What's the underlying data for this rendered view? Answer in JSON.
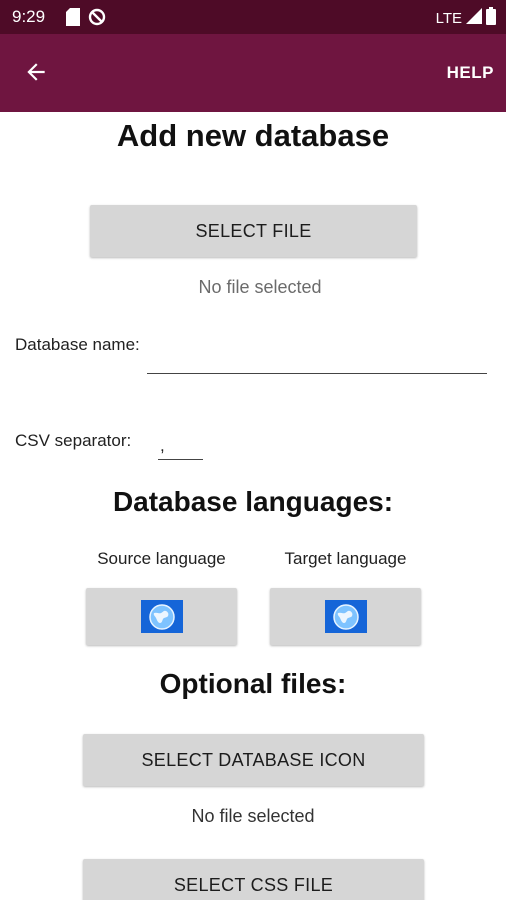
{
  "status_bar": {
    "time": "9:29",
    "network": "LTE"
  },
  "app_bar": {
    "back_icon": "arrow-left-icon",
    "help_label": "HELP",
    "background": "#6f1540"
  },
  "form": {
    "title": "Add new database",
    "select_file_label": "SELECT FILE",
    "no_file_text": "No file selected",
    "db_name_label": "Database name:",
    "db_name_value": "",
    "csv_separator_label": "CSV separator:",
    "csv_separator_value": ","
  },
  "languages": {
    "title": "Database languages:",
    "source_label": "Source language",
    "target_label": "Target language",
    "icon": "globe-icon"
  },
  "optional": {
    "title": "Optional files:",
    "select_icon_label": "SELECT DATABASE ICON",
    "no_file_text": "No file selected",
    "select_css_label": "SELECT CSS FILE"
  }
}
